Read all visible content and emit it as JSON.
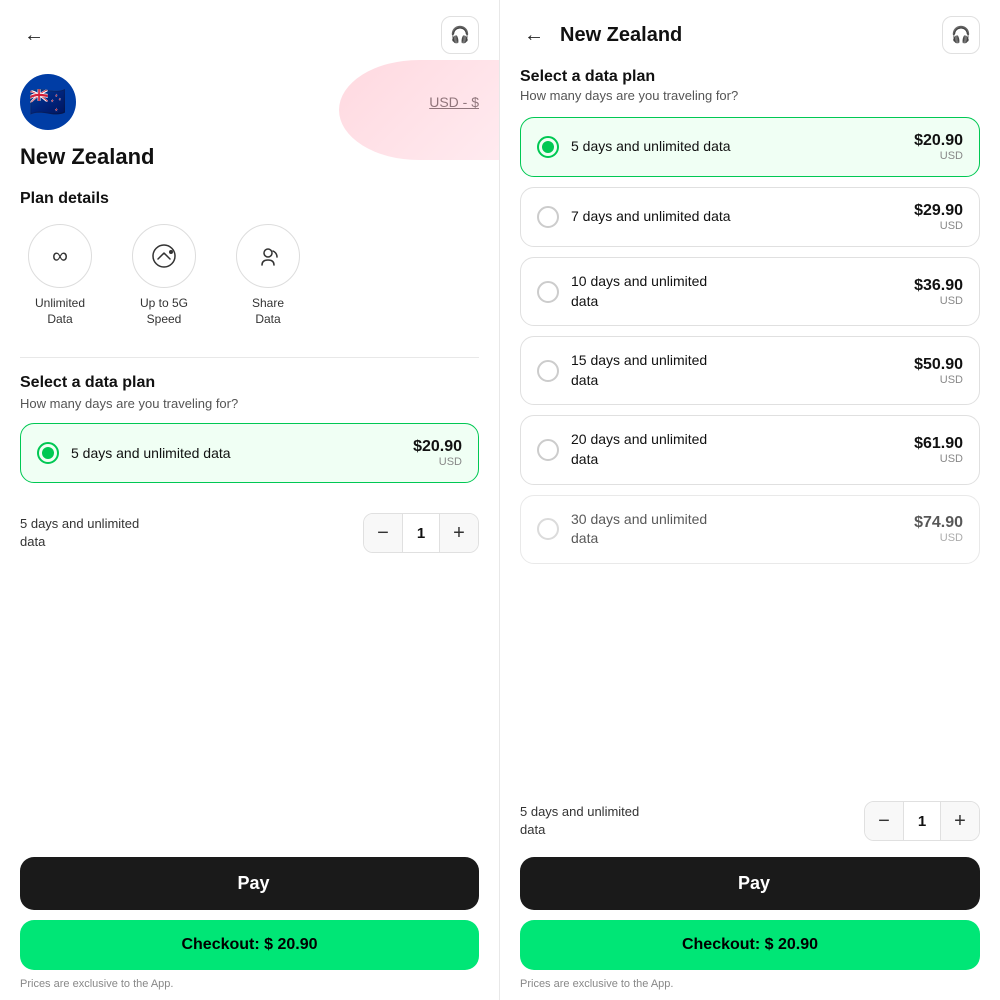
{
  "left": {
    "back_label": "←",
    "support_icon": "🎧",
    "country": "New Zealand",
    "flag_emoji": "🇳🇿",
    "currency_label": "USD - $",
    "plan_details_title": "Plan details",
    "features": [
      {
        "icon": "∞",
        "label": "Unlimited\nData"
      },
      {
        "icon": "◎",
        "label": "Up to 5G\nSpeed"
      },
      {
        "icon": "📡",
        "label": "Share\nData"
      }
    ],
    "select_plan_title": "Select a data plan",
    "select_plan_subtitle": "How many days are you traveling for?",
    "selected_plan": {
      "name": "5 days and unlimited data",
      "price": "$20.90",
      "currency": "USD"
    },
    "quantity_label": "5 days and unlimited\ndata",
    "quantity": "1",
    "apple_pay_label": "Pay",
    "checkout_label": "Checkout: $ 20.90",
    "prices_note": "Prices are exclusive to the App."
  },
  "right": {
    "back_label": "←",
    "title": "New Zealand",
    "support_icon": "🎧",
    "select_plan_title": "Select a data plan",
    "select_plan_subtitle": "How many days are you traveling for?",
    "plans": [
      {
        "name": "5 days and unlimited data",
        "price": "$20.90",
        "currency": "USD",
        "selected": true
      },
      {
        "name": "7 days and unlimited data",
        "price": "$29.90",
        "currency": "USD",
        "selected": false
      },
      {
        "name": "10 days and unlimited\ndata",
        "price": "$36.90",
        "currency": "USD",
        "selected": false
      },
      {
        "name": "15 days and unlimited\ndata",
        "price": "$50.90",
        "currency": "USD",
        "selected": false
      },
      {
        "name": "20 days and unlimited\ndata",
        "price": "$61.90",
        "currency": "USD",
        "selected": false
      },
      {
        "name": "30 days and unlimited",
        "price": "$74.90",
        "currency": "USD",
        "selected": false
      }
    ],
    "quantity_label": "5 days and unlimited\ndata",
    "quantity": "1",
    "apple_pay_label": "Pay",
    "checkout_label": "Checkout: $ 20.90",
    "prices_note": "Prices are exclusive to the App."
  }
}
